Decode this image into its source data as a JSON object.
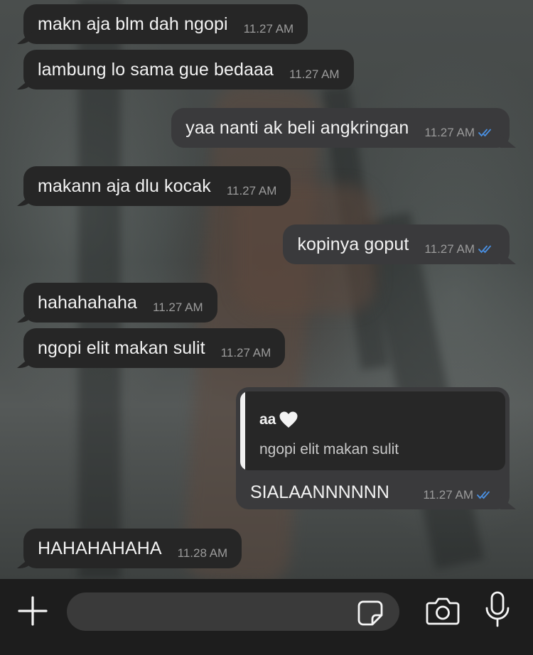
{
  "messages": [
    {
      "direction": "in",
      "text": "makn aja blm dah ngopi",
      "time": "11.27 AM"
    },
    {
      "direction": "in",
      "text": "lambung lo sama gue bedaaa",
      "time": "11.27 AM"
    },
    {
      "direction": "out",
      "text": "yaa nanti ak beli angkringan",
      "time": "11.27 AM",
      "status": "read"
    },
    {
      "direction": "in",
      "text": "makann aja dlu kocak",
      "time": "11.27 AM"
    },
    {
      "direction": "out",
      "text": "kopinya goput",
      "time": "11.27 AM",
      "status": "read"
    },
    {
      "direction": "in",
      "text": "hahahahaha",
      "time": "11.27 AM"
    },
    {
      "direction": "in",
      "text": "ngopi elit makan sulit",
      "time": "11.27 AM"
    }
  ],
  "reply_message": {
    "direction": "out",
    "quoted_name": "aa",
    "quoted_emoji": "white-heart-icon",
    "quoted_text": "ngopi elit makan sulit",
    "text": "SIALAANNNNNN",
    "time": "11.27 AM",
    "status": "read"
  },
  "last_message": {
    "direction": "in",
    "text": "HAHAHAHAHA",
    "time": "11.28 AM"
  },
  "composer": {
    "placeholder": "",
    "icons": [
      "plus-icon",
      "sticker-icon",
      "camera-icon",
      "microphone-icon"
    ]
  },
  "colors": {
    "incoming_bubble": "#262626",
    "outgoing_bubble": "#3a3a3c",
    "read_ticks": "#4a90e2",
    "input_bar": "#1d1d1d"
  }
}
